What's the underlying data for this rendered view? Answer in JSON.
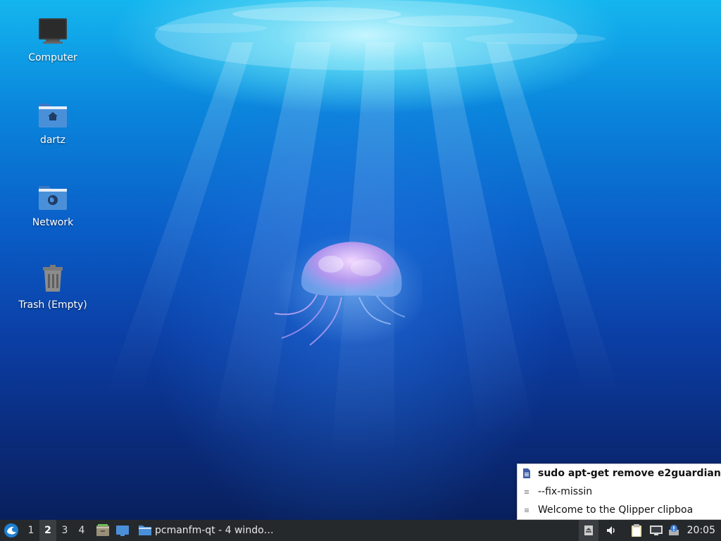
{
  "desktop": {
    "icons": [
      {
        "label": "Computer",
        "icon": "computer-icon"
      },
      {
        "label": "dartz",
        "icon": "home-folder-icon"
      },
      {
        "label": "Network",
        "icon": "network-folder-icon"
      },
      {
        "label": "Trash (Empty)",
        "icon": "trash-icon"
      }
    ],
    "wallpaper": "jellyfish"
  },
  "taskbar": {
    "start_icon": "lxqt-menu-icon",
    "workspaces": [
      "1",
      "2",
      "3",
      "4"
    ],
    "active_workspace": "2",
    "quicklaunch": [
      "file-manager-icon",
      "show-desktop-icon"
    ],
    "task": {
      "label": "pcmanfm-qt - 4 windo…",
      "icon": "folder-icon"
    },
    "tray_icons": [
      "eject-icon",
      "volume-icon",
      "clipboard-icon",
      "network-icon",
      "update-notifier-icon"
    ],
    "clock": "20:05"
  },
  "clipboard_menu": {
    "items": [
      {
        "label": "sudo apt-get remove e2guardian",
        "bold": true
      },
      {
        "label": "--fix-missin",
        "bold": false
      },
      {
        "label": "Welcome to the Qlipper clipboa",
        "bold": false
      }
    ]
  },
  "colors": {
    "taskbar_bg": "#26292c",
    "folder_blue": "#4a90d9",
    "accent": "#1e9ae0"
  }
}
